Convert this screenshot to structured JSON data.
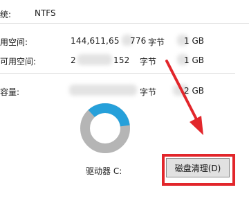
{
  "properties": {
    "filesystem": {
      "label": "统:",
      "value": "NTFS"
    },
    "used": {
      "label": "用空间:",
      "bytes_visible_start": "144,611,65",
      "bytes_visible_end": "776",
      "unit": "字节",
      "size": "1 GB"
    },
    "free": {
      "label": "可用空间:",
      "bytes_visible_start": "2",
      "bytes_visible_end": "152",
      "unit": "字节",
      "size": "1 GB"
    },
    "capacity": {
      "label": "容量:",
      "unit": "字节",
      "size": "2 GB"
    }
  },
  "usage_chart": {
    "used_fraction": 0.35,
    "used_color": "#26a0da",
    "free_color": "#b5b5b5"
  },
  "drive_label": "驱动器 C:",
  "disk_cleanup_button": "磁盘清理(D)",
  "annotation": {
    "arrow_color": "#e2262b",
    "box_color": "#e2262b"
  }
}
